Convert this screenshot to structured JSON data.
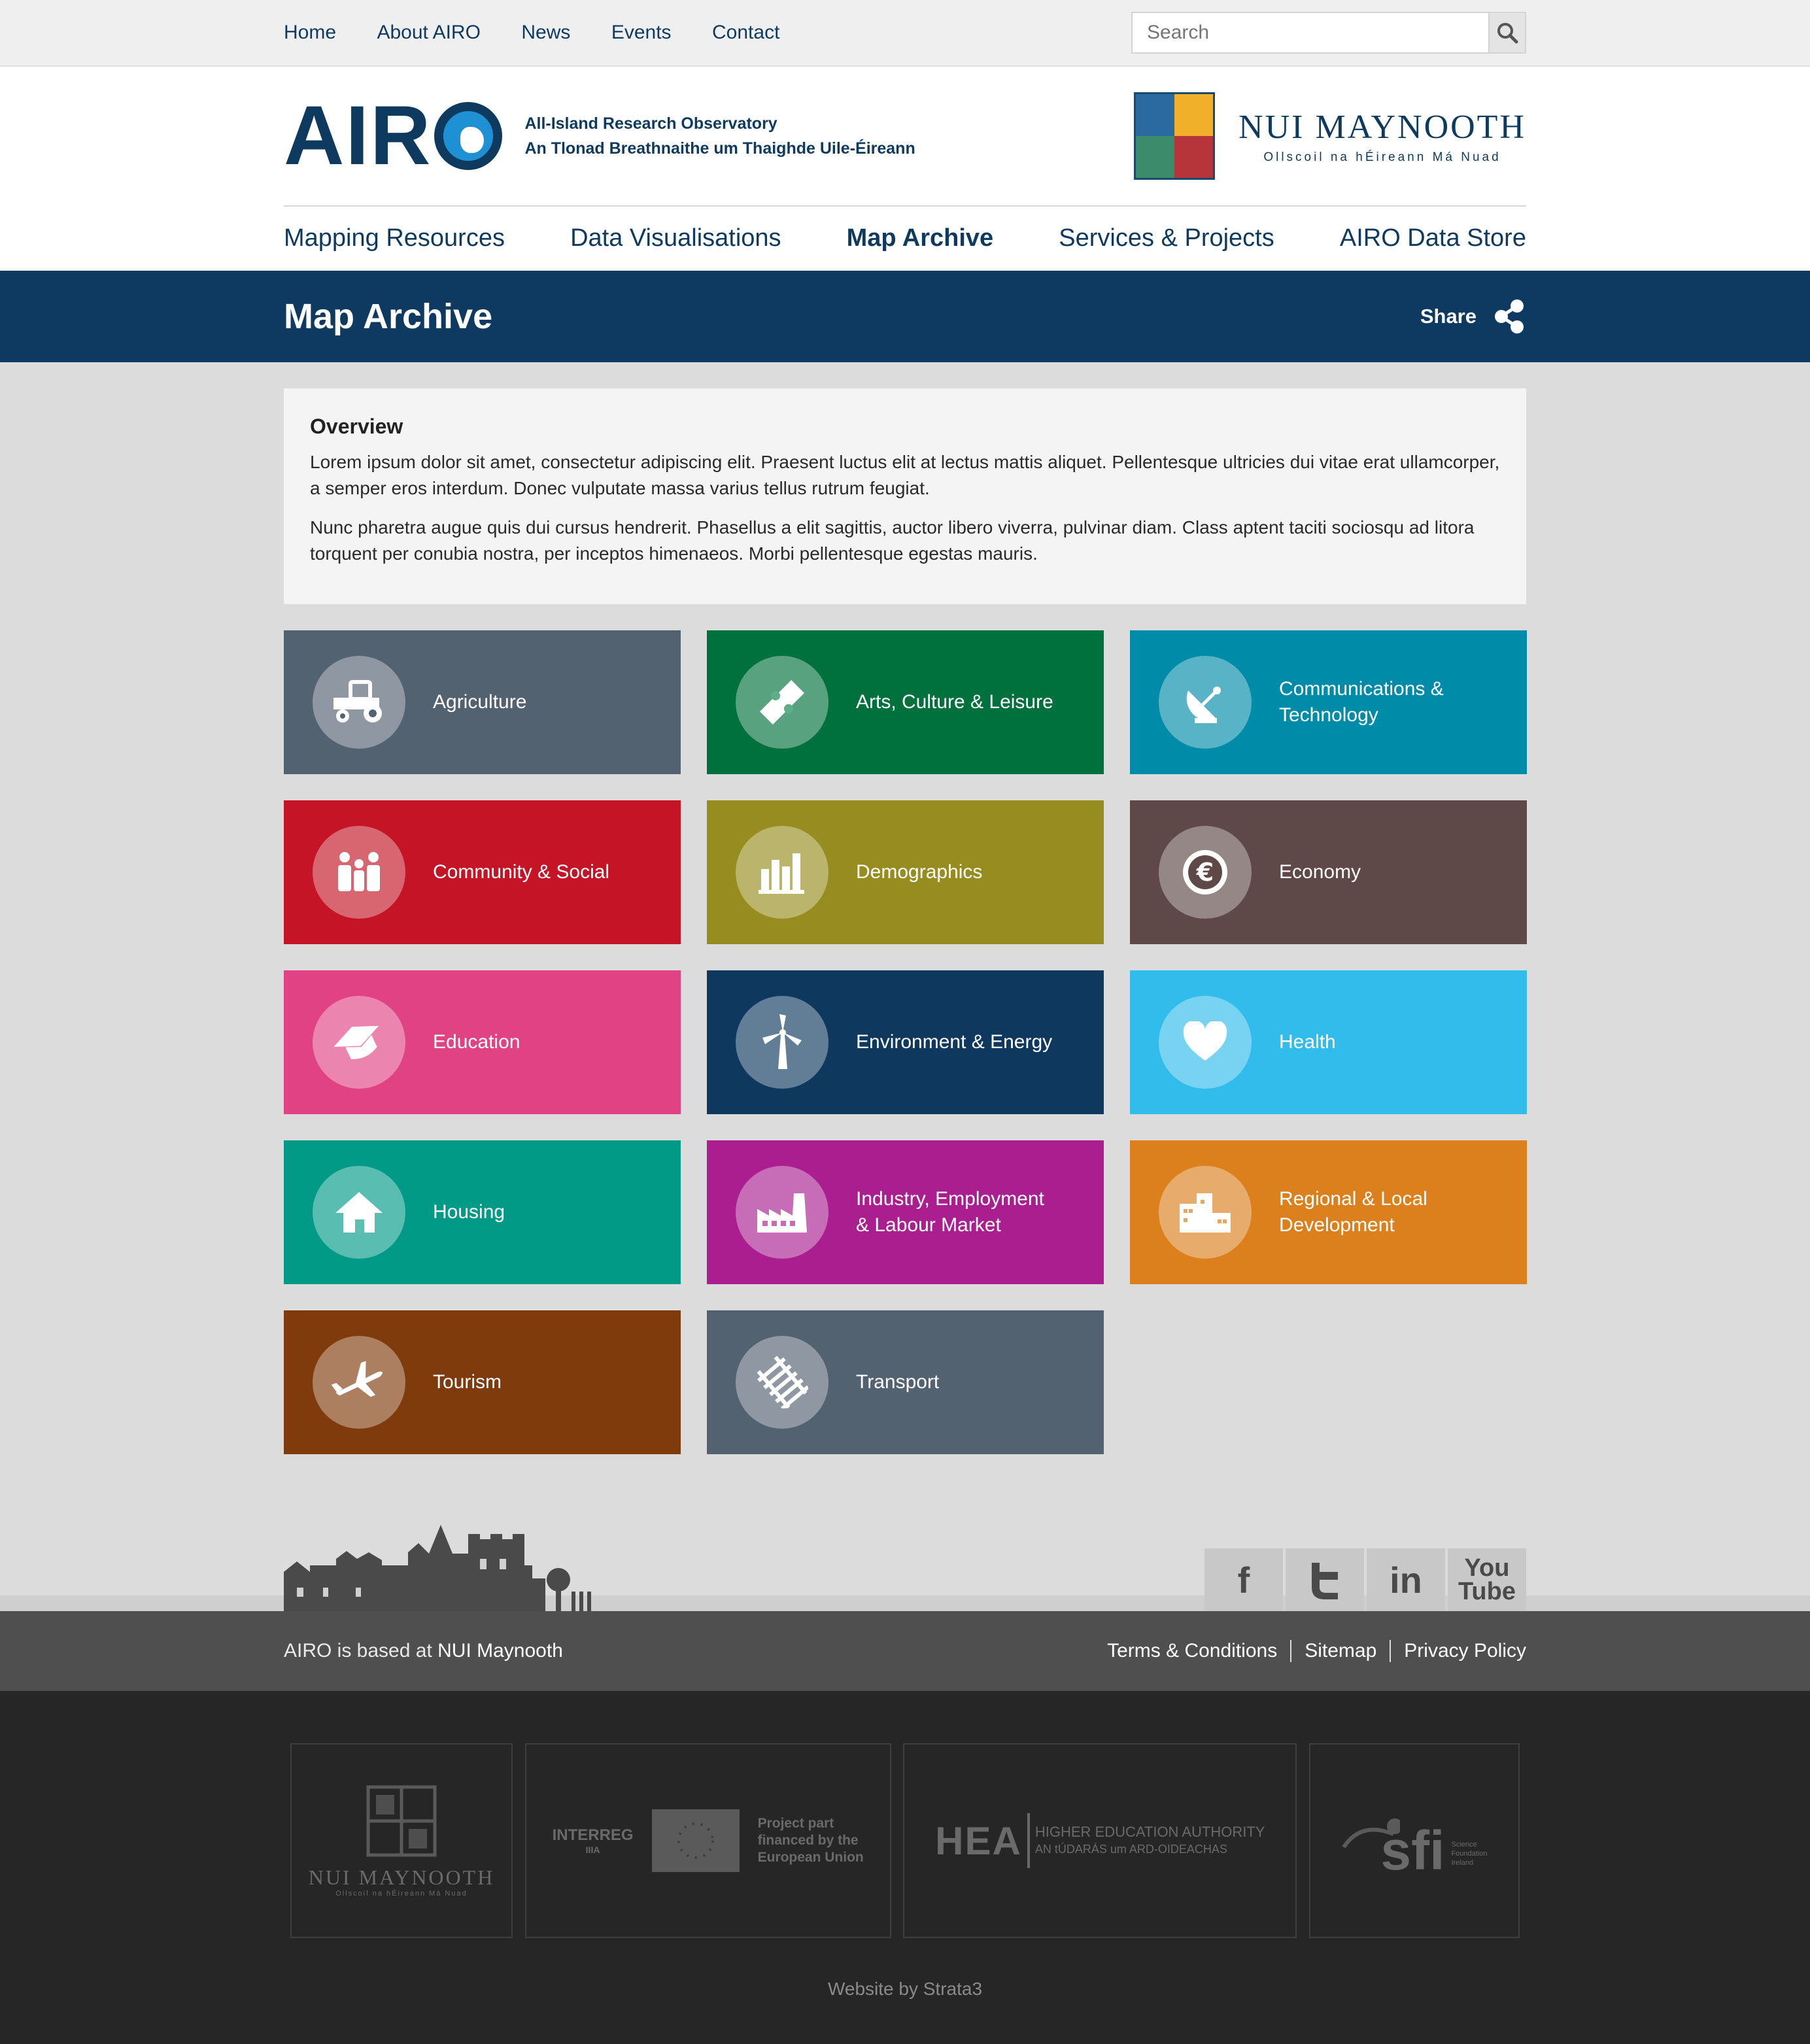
{
  "topnav": {
    "items": [
      "Home",
      "About AIRO",
      "News",
      "Events",
      "Contact"
    ]
  },
  "search": {
    "placeholder": "Search"
  },
  "header": {
    "logo_text_start": "AIR",
    "tagline_line1": "All-Island Research Observatory",
    "tagline_line2": "An Tlonad Breathnaithe um Thaighde Uile-Éireann",
    "university_name": "NUI MAYNOOTH",
    "university_subtitle": "Ollscoil na hÉireann Má Nuad"
  },
  "mainnav": {
    "items": [
      "Mapping Resources",
      "Data Visualisations",
      "Map Archive",
      "Services & Projects",
      "AIRO Data Store"
    ],
    "active": "Map Archive"
  },
  "titlebar": {
    "title": "Map Archive",
    "share_label": "Share"
  },
  "overview": {
    "heading": "Overview",
    "para1": "Lorem ipsum dolor sit amet, consectetur adipiscing elit. Praesent luctus elit at lectus mattis aliquet. Pellentesque ultricies dui vitae erat ullamcorper, a semper eros interdum. Donec vulputate massa varius tellus rutrum feugiat.",
    "para2": "Nunc pharetra augue quis dui cursus hendrerit. Phasellus a elit sagittis, auctor libero viverra, pulvinar diam. Class aptent taciti sociosqu ad litora torquent per conubia nostra, per inceptos himenaeos. Morbi pellentesque egestas mauris."
  },
  "categories": [
    {
      "label": "Agriculture",
      "color": "#536270",
      "icon": "tractor-icon"
    },
    {
      "label": "Arts, Culture & Leisure",
      "color": "#00703c",
      "icon": "ticket-icon"
    },
    {
      "label": "Communications & Technology",
      "color": "#008ba8",
      "icon": "satellite-dish-icon"
    },
    {
      "label": "Community & Social",
      "color": "#c41425",
      "icon": "people-icon"
    },
    {
      "label": "Demographics",
      "color": "#978c20",
      "icon": "bar-chart-icon"
    },
    {
      "label": "Economy",
      "color": "#5e4848",
      "icon": "euro-icon"
    },
    {
      "label": "Education",
      "color": "#e04284",
      "icon": "graduation-cap-icon"
    },
    {
      "label": "Environment & Energy",
      "color": "#0f385f",
      "icon": "wind-turbine-icon"
    },
    {
      "label": "Health",
      "color": "#31bceb",
      "icon": "heart-icon"
    },
    {
      "label": "Housing",
      "color": "#009a87",
      "icon": "house-icon"
    },
    {
      "label": "Industry, Employment & Labour Market",
      "color": "#aa1e8f",
      "icon": "factory-icon"
    },
    {
      "label": "Regional & Local Development",
      "color": "#db801c",
      "icon": "buildings-icon"
    },
    {
      "label": "Tourism",
      "color": "#7f3b0c",
      "icon": "airplane-icon"
    },
    {
      "label": "Transport",
      "color": "#536270",
      "icon": "railway-icon"
    }
  ],
  "social": {
    "facebook": "f",
    "linkedin": "in",
    "youtube_line1": "You",
    "youtube_line2": "Tube"
  },
  "footer": {
    "based_prefix": "AIRO is based at",
    "based_link": "NUI Maynooth",
    "links": [
      "Terms & Conditions",
      "Sitemap",
      "Privacy Policy"
    ],
    "partners": {
      "nuim_name": "NUI MAYNOOTH",
      "nuim_sub": "Ollscoil na hÉireann Má Nuad",
      "interreg": "INTERREG",
      "interreg_sub": "IIIA",
      "eu_line1": "Project part",
      "eu_line2": "financed by the",
      "eu_line3": "European Union",
      "hea": "HEA",
      "hea_line1": "HIGHER EDUCATION AUTHORITY",
      "hea_line2": "AN tÚDARÁS um ARD-OIDEACHAS",
      "sfi": "sfi",
      "sfi_sub1": "Science",
      "sfi_sub2": "Foundation",
      "sfi_sub3": "Ireland"
    },
    "credit": "Website by Strata3"
  }
}
